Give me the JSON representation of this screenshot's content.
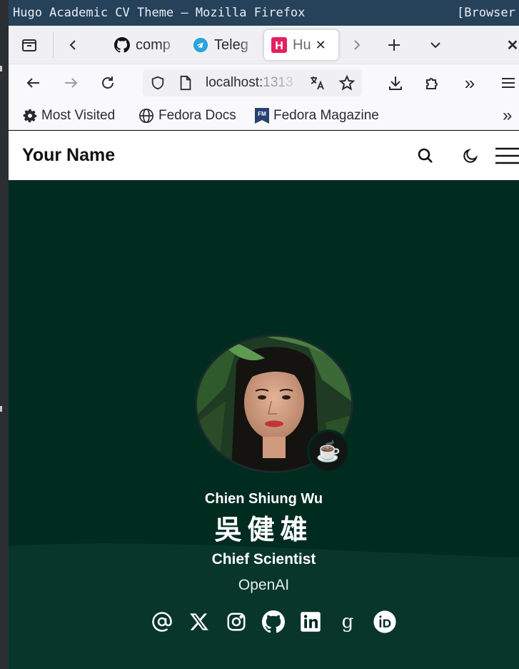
{
  "window": {
    "title": "Hugo Academic CV Theme — Mozilla Firefox",
    "title_right": "[Browser"
  },
  "tabs": [
    {
      "label": "comp",
      "icon": "github-icon"
    },
    {
      "label": "Teleg",
      "icon": "telegram-icon"
    },
    {
      "label": "Hu",
      "icon": "hugo-icon",
      "active": true
    }
  ],
  "navbar": {
    "url_host": "localhost:",
    "url_port": "1313"
  },
  "bookmarks": [
    {
      "label": "Most Visited",
      "icon": "gear-icon"
    },
    {
      "label": "Fedora Docs",
      "icon": "globe-icon"
    },
    {
      "label": "Fedora Magazine",
      "icon": "fm-icon"
    }
  ],
  "site": {
    "brand": "Your Name"
  },
  "profile": {
    "name": "Chien Shiung Wu",
    "name_cjk": "吳健雄",
    "role": "Chief Scientist",
    "organization": "OpenAI",
    "status_emoji": "☕"
  },
  "socials": [
    "at-icon",
    "x-icon",
    "instagram-icon",
    "github-icon",
    "linkedin-icon",
    "google-scholar-icon",
    "orcid-icon"
  ],
  "colors": {
    "hero_bg": "#002b1f",
    "titlebar_bg": "#26415a",
    "accent_hugo": "#e3215e"
  }
}
